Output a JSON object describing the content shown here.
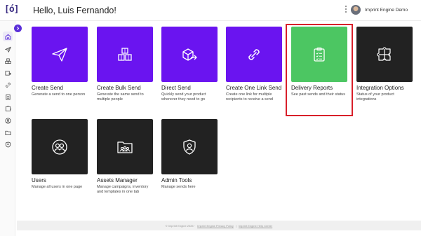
{
  "header": {
    "logo": "[ó]",
    "greeting": "Hello, Luis Fernando!",
    "user_name": "Imprint Engine Demo"
  },
  "sidebar": {
    "items": [
      {
        "icon": "home-icon",
        "active": true
      },
      {
        "icon": "paper-plane-icon"
      },
      {
        "icon": "boxes-icon"
      },
      {
        "icon": "box-arrow-icon"
      },
      {
        "icon": "link-icon"
      },
      {
        "icon": "clipboard-icon"
      },
      {
        "icon": "puzzle-icon"
      },
      {
        "icon": "users-icon"
      },
      {
        "icon": "folder-icon"
      },
      {
        "icon": "shield-user-icon"
      }
    ]
  },
  "tiles": [
    {
      "title": "Create Send",
      "desc": "Generate a send to one person",
      "color": "#6a14f0",
      "icon": "paper-plane-icon"
    },
    {
      "title": "Create Bulk Send",
      "desc": "Generate the same send to multiple people",
      "color": "#6a14f0",
      "icon": "boxes-icon"
    },
    {
      "title": "Direct Send",
      "desc": "Quickly send your product wherever they need to go",
      "color": "#6a14f0",
      "icon": "box-arrow-icon"
    },
    {
      "title": "Create One Link Send",
      "desc": "Create one link for multiple recipients to receive a send",
      "color": "#6a14f0",
      "icon": "link-icon"
    },
    {
      "title": "Delivery Reports",
      "desc": "See past sends and their status",
      "color": "#4cc662",
      "icon": "clipboard-icon"
    },
    {
      "title": "Integration Options",
      "desc": "Status of your product integrations",
      "color": "#222222",
      "icon": "puzzle-icon"
    },
    {
      "title": "Users",
      "desc": "Manage all users in one page",
      "color": "#222222",
      "icon": "users-icon"
    },
    {
      "title": "Assets Manager",
      "desc": "Manage campaigns, inventory and templates in one tab",
      "color": "#222222",
      "icon": "folder-icon"
    },
    {
      "title": "Admin Tools",
      "desc": "Manage sends here",
      "color": "#222222",
      "icon": "shield-user-icon"
    }
  ],
  "footer": {
    "copyright": "© Imprint Engine 2025 ·",
    "privacy": "Imprint Engine Privacy Policy",
    "sep": "|",
    "help": "Imprint Engine Help Center"
  }
}
